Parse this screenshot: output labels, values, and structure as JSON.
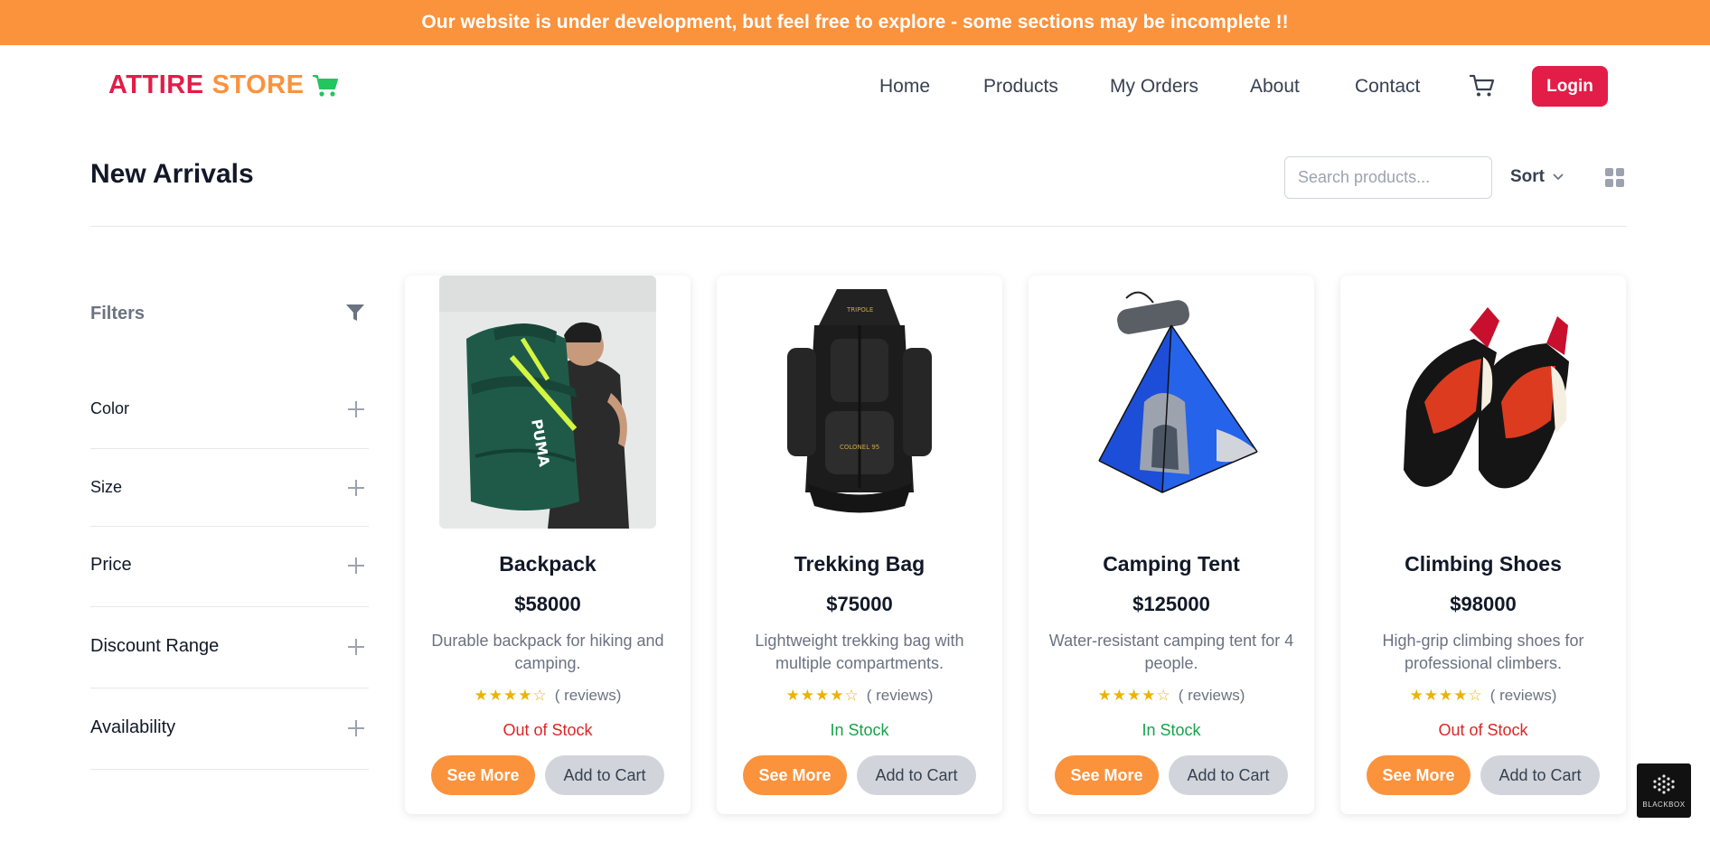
{
  "banner": {
    "text": "Our website is under development, but feel free to explore - some sections may be incomplete !!"
  },
  "logo": {
    "word1": "ATTIRE",
    "word2": "STORE",
    "icon": "shopping-cart-icon"
  },
  "nav": {
    "items": [
      "Home",
      "Products",
      "My Orders",
      "About",
      "Contact"
    ],
    "cart_icon": "cart-icon",
    "login_label": "Login"
  },
  "toolbar": {
    "title": "New Arrivals",
    "search_placeholder": "Search products...",
    "sort_label": "Sort",
    "view_icon": "grid-view-icon"
  },
  "filters": {
    "title": "Filters",
    "icon": "funnel-icon",
    "items": [
      "Color",
      "Size",
      "Price",
      "Discount Range",
      "Availability"
    ]
  },
  "products": [
    {
      "name": "Backpack",
      "price": "$58000",
      "description": "Durable backpack for hiking and camping.",
      "stars": "★★★★☆",
      "rating_value": 4,
      "reviews": "( reviews)",
      "stock": "Out of Stock",
      "see_more": "See More",
      "add_to_cart": "Add to Cart"
    },
    {
      "name": "Trekking Bag",
      "price": "$75000",
      "description": "Lightweight trekking bag with multiple compartments.",
      "stars": "★★★★☆",
      "rating_value": 4,
      "reviews": "( reviews)",
      "stock": "In Stock",
      "see_more": "See More",
      "add_to_cart": "Add to Cart"
    },
    {
      "name": "Camping Tent",
      "price": "$125000",
      "description": "Water-resistant camping tent for 4 people.",
      "stars": "★★★★☆",
      "rating_value": 4,
      "reviews": "( reviews)",
      "stock": "In Stock",
      "see_more": "See More",
      "add_to_cart": "Add to Cart"
    },
    {
      "name": "Climbing Shoes",
      "price": "$98000",
      "description": "High-grip climbing shoes for professional climbers.",
      "stars": "★★★★☆",
      "rating_value": 4,
      "reviews": "( reviews)",
      "stock": "Out of Stock",
      "see_more": "See More",
      "add_to_cart": "Add to Cart"
    }
  ],
  "badge": {
    "text": "BLACKBOX"
  },
  "colors": {
    "accent": "#fb923c",
    "brand": "#e11d48",
    "in_stock": "#16a34a",
    "out_of_stock": "#dc2626",
    "star": "#eab308"
  }
}
